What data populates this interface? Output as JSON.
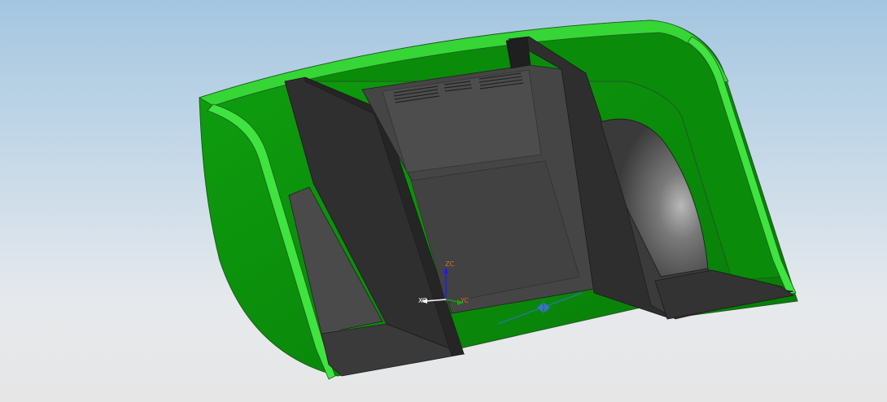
{
  "viewport": {
    "background_top": "#a4c6e0",
    "background_bottom": "#e6e6e6"
  },
  "model": {
    "outer_shell_color": "#0a9a0a",
    "edge_highlight_color": "#3fe43f",
    "inner_panel_color": "#3c3c3c",
    "vents_count": 3
  },
  "triad": {
    "z_label": "ZC",
    "y_label": "YC",
    "x_label": "XC",
    "z_color": "#1a1aff",
    "y_color": "#1aa01a",
    "x_color": "#ffffff",
    "label_color": "#e07020"
  },
  "dimension_marker": {
    "color": "#3a6fd0",
    "icon": "dimension-arrow-icon"
  }
}
